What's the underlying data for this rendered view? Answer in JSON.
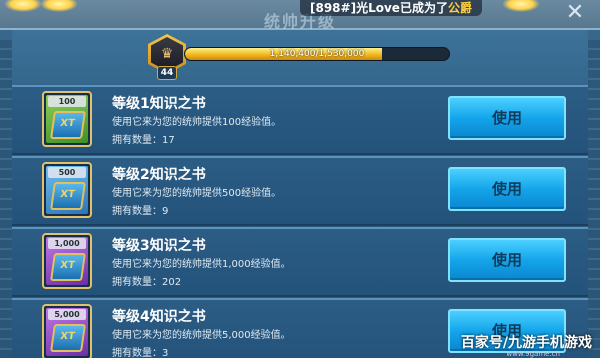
{
  "window": {
    "title": "统帅升级",
    "close_glyph": "✕"
  },
  "notification": {
    "prefix": "[898#]",
    "player": "光Love",
    "middle": "已成为了",
    "rank": "公爵"
  },
  "commander": {
    "level": "44",
    "xp_text": "1,140,400/1,530,000",
    "xp_fraction": 0.745
  },
  "items": [
    {
      "tag": "100",
      "title": "等级1知识之书",
      "desc": "使用它来为您的统帅提供100经验值。",
      "count": "拥有数量：17",
      "button": "使用",
      "color": "green"
    },
    {
      "tag": "500",
      "title": "等级2知识之书",
      "desc": "使用它来为您的统帅提供500经验值。",
      "count": "拥有数量：9",
      "button": "使用",
      "color": "blue"
    },
    {
      "tag": "1,000",
      "title": "等级3知识之书",
      "desc": "使用它来为您的统帅提供1,000经验值。",
      "count": "拥有数量：202",
      "button": "使用",
      "color": "purple"
    },
    {
      "tag": "5,000",
      "title": "等级4知识之书",
      "desc": "使用它来为您的统帅提供5,000经验值。",
      "count": "拥有数量：3",
      "button": "使用",
      "color": "purple"
    }
  ],
  "watermark": "百家号/九游手机游戏",
  "watermark_sub": "www.9game.cn"
}
